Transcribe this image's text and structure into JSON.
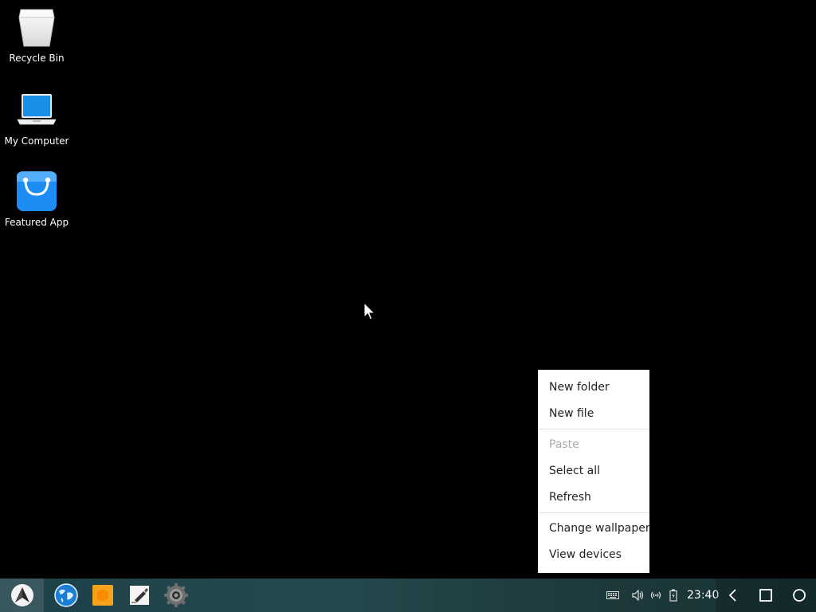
{
  "desktop": {
    "icons": [
      {
        "label": "Recycle Bin",
        "icon": "recycle-bin-icon"
      },
      {
        "label": "My Computer",
        "icon": "laptop-icon"
      },
      {
        "label": "Featured App",
        "icon": "shopping-bag-icon"
      }
    ]
  },
  "context_menu": {
    "groups": [
      [
        {
          "label": "New folder",
          "enabled": true
        },
        {
          "label": "New file",
          "enabled": true
        }
      ],
      [
        {
          "label": "Paste",
          "enabled": false
        },
        {
          "label": "Select all",
          "enabled": true
        },
        {
          "label": "Refresh",
          "enabled": true
        }
      ],
      [
        {
          "label": "Change wallpaper",
          "enabled": true
        },
        {
          "label": "View devices",
          "enabled": true
        }
      ]
    ]
  },
  "taskbar": {
    "start_icon": "start-menu-icon",
    "apps": [
      {
        "name": "browser",
        "icon": "globe-browser-icon"
      },
      {
        "name": "files",
        "icon": "folder-files-icon"
      },
      {
        "name": "notes",
        "icon": "note-editor-icon"
      },
      {
        "name": "settings",
        "icon": "gear-settings-icon"
      }
    ],
    "tray": {
      "icons": [
        "keyboard-icon",
        "volume-icon",
        "wifi-signal-icon",
        "battery-icon"
      ],
      "clock": "23:40"
    },
    "nav": [
      "back-icon",
      "recents-icon",
      "home-icon"
    ]
  },
  "colors": {
    "taskbar_bg": "#1f3c42",
    "menu_bg": "#ffffff",
    "menu_text": "#222222",
    "menu_disabled_text": "#aaaaaa",
    "desktop_bg": "#000000",
    "accent_blue": "#1e90ff",
    "files_orange": "#f7a21b"
  }
}
